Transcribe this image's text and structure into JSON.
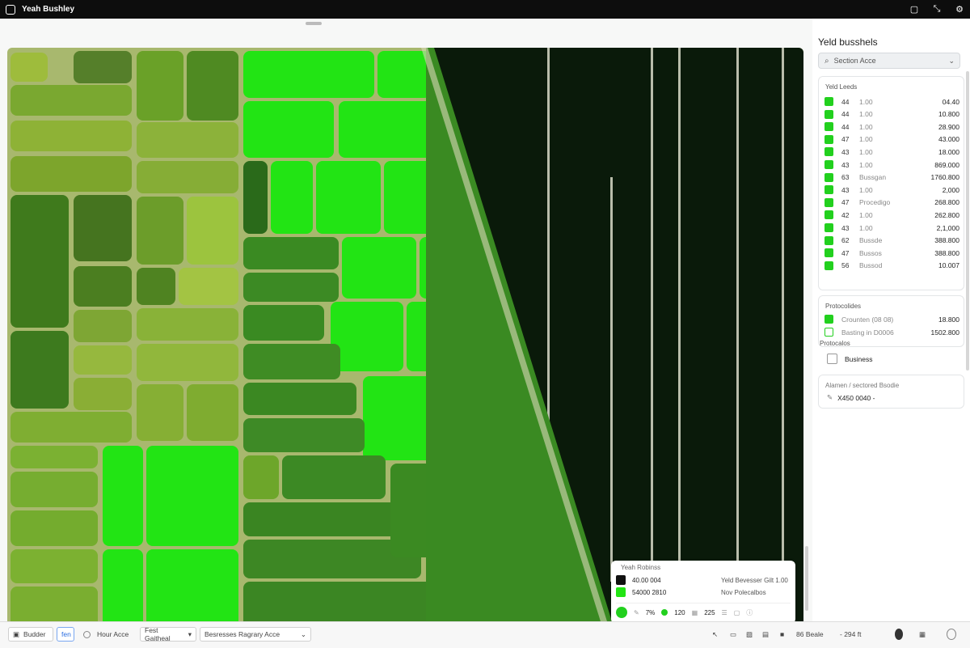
{
  "window": {
    "title": "Yeah Bushley"
  },
  "sidebar": {
    "title": "Yeld busshels",
    "search_label": "Section Acce",
    "yield_panel_title": "Yeld Leeds",
    "yield_rows": [
      {
        "n": "44",
        "label": "1.00",
        "value": "04.40"
      },
      {
        "n": "44",
        "label": "1.00",
        "value": "10.800"
      },
      {
        "n": "44",
        "label": "1.00",
        "value": "28.900"
      },
      {
        "n": "47",
        "label": "1.00",
        "value": "43.000"
      },
      {
        "n": "43",
        "label": "1.00",
        "value": "18.000"
      },
      {
        "n": "43",
        "label": "1.00",
        "value": "869.000"
      },
      {
        "n": "63",
        "label": "Bussgan",
        "value": "1760.800"
      },
      {
        "n": "43",
        "label": "1.00",
        "value": "2,000"
      },
      {
        "n": "47",
        "label": "Procedigo",
        "value": "268.800"
      },
      {
        "n": "42",
        "label": "1.00",
        "value": "262.800"
      },
      {
        "n": "43",
        "label": "1.00",
        "value": "2,1,000"
      },
      {
        "n": "62",
        "label": "Bussde",
        "value": "388.800"
      },
      {
        "n": "47",
        "label": "Bussos",
        "value": "388.800"
      },
      {
        "n": "56",
        "label": "Bussod",
        "value": "10.007"
      }
    ],
    "protocols_title": "Protocolides",
    "protocols": [
      {
        "label": "Crounten (08 08)",
        "value": "18.800"
      },
      {
        "label": "Basting in D0006",
        "value": "1502.800"
      }
    ],
    "protection_title": "Protocalos",
    "protection_checkbox": "Business",
    "note_title": "Alamen / sectored Bsodie",
    "note_value": "X450 0040 -"
  },
  "map_legend": {
    "header": "Yeah Robinss",
    "row1": {
      "value": "40.00 004",
      "desc": "Yeld  Bevesser Gilt  1.00"
    },
    "row2": {
      "value": "54000 2810",
      "desc": "Nov  Polecalbos"
    },
    "footer": [
      "7%",
      "120",
      "225"
    ]
  },
  "bottombar": {
    "b1": "Budder",
    "b2": "fen",
    "b3": "Hour Acce",
    "b4": "Fest Gaitheal",
    "b5": "Besresses Ragrary  Acce",
    "zoom": "86  Beale",
    "scale": "- 294 ft"
  },
  "colors": {
    "bright_green": "#22e414",
    "dark_field": "#0a1a0a",
    "swatch_green": "#22d01e"
  }
}
